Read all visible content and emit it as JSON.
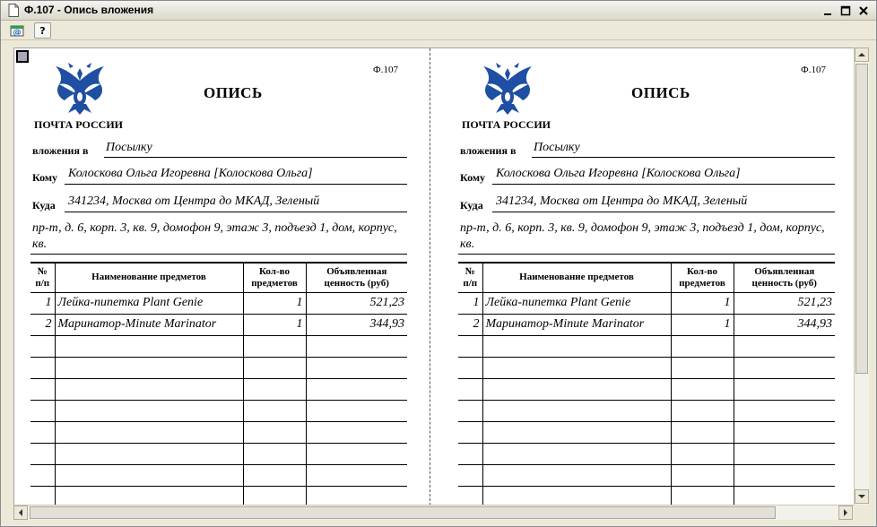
{
  "window": {
    "title": "Ф.107 - Опись вложения",
    "buttons": {
      "minimize": "–",
      "maximize": "□",
      "close": "×"
    }
  },
  "toolbar": {
    "email_icon": "email-icon",
    "help_label": "?"
  },
  "form": {
    "code": "Ф.107",
    "title": "ОПИСЬ",
    "org": "ПОЧТА РОССИИ",
    "fields": {
      "attachment_label": "вложения в",
      "attachment_value": "Посылку",
      "to_label": "Кому",
      "to_value": "Колоскова Ольга Игоревна [Колоскова Ольга]",
      "address_label": "Куда",
      "address_value_1": "341234, Москва от Центра до МКАД, Зеленый",
      "address_value_2": "пр-т, д. 6, корп. 3, кв. 9, домофон 9, этаж 3, подъезд 1, дом, корпус, кв."
    },
    "table": {
      "headers": {
        "num": "№ п/п",
        "name": "Наименование предметов",
        "qty": "Кол-во предметов",
        "value": "Объявленная ценность (руб)"
      },
      "rows": [
        {
          "num": "1",
          "name": "Лейка-пипетка Plant Genie",
          "qty": "1",
          "value": "521,23"
        },
        {
          "num": "2",
          "name": "Маринатор-Minute Marinator",
          "qty": "1",
          "value": "344,93"
        }
      ],
      "empty_rows": 8
    }
  },
  "colors": {
    "emblem": "#1e4fa3",
    "window_bg": "#ece9d8"
  }
}
